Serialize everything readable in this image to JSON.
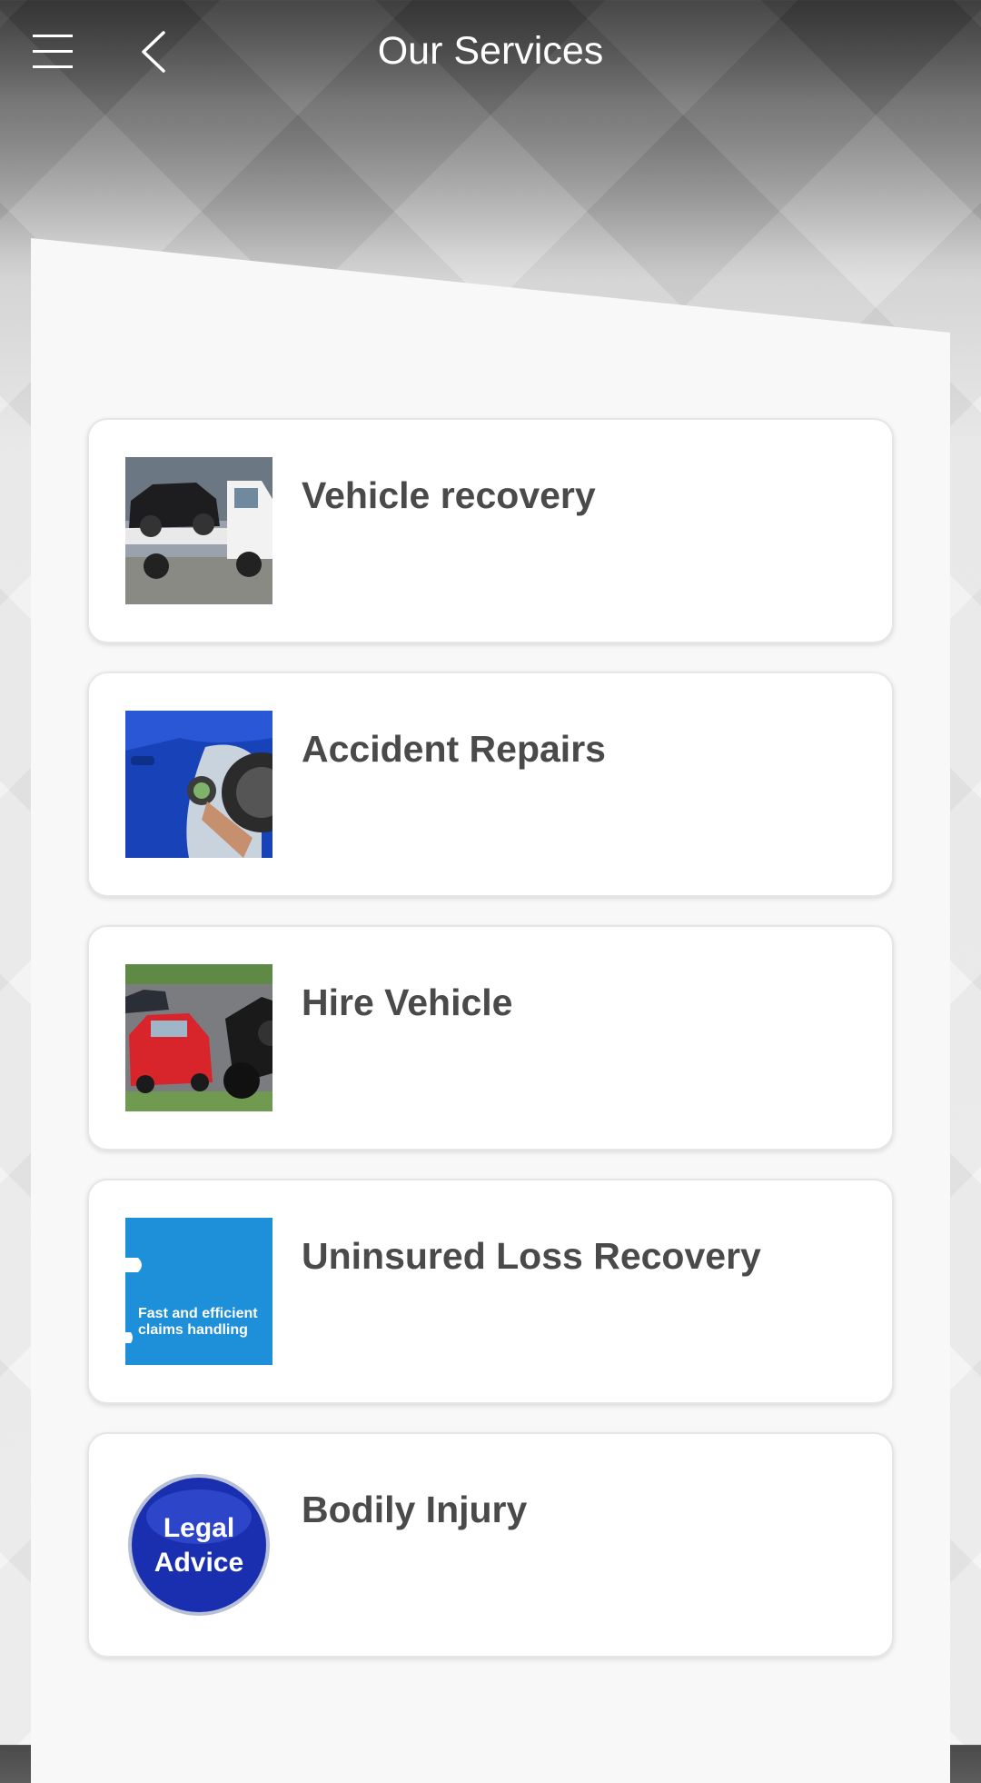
{
  "header": {
    "title": "Our Services",
    "menu_icon": "hamburger-menu-icon",
    "back_icon": "chevron-left-icon"
  },
  "services": [
    {
      "label": "Vehicle recovery",
      "image": "tow-truck-photo"
    },
    {
      "label": "Accident Repairs",
      "image": "car-bodywork-repair-photo"
    },
    {
      "label": "Hire Vehicle",
      "image": "car-and-motorbike-racing-photo"
    },
    {
      "label": "Uninsured Loss Recovery",
      "image": "claims-handling-graphic",
      "image_text": "Fast and efficient claims handling"
    },
    {
      "label": "Bodily Injury",
      "image": "legal-advice-badge",
      "image_text_line1": "Legal",
      "image_text_line2": "Advice"
    }
  ],
  "colors": {
    "header_text": "#ffffff",
    "item_text": "#4a4a4a",
    "claims_blue": "#1e8fd9",
    "legal_badge_blue": "#1a2fb0"
  }
}
